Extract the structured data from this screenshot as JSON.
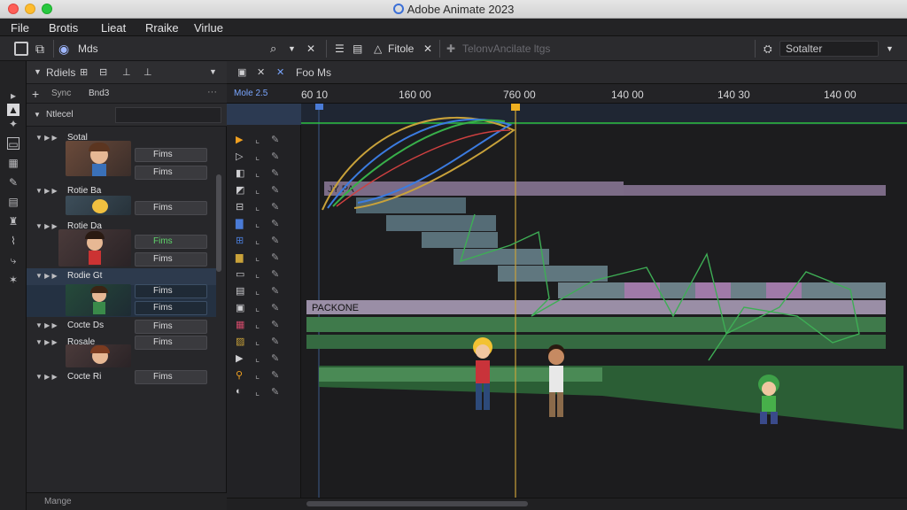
{
  "window": {
    "title": "Adobe Animate 2023"
  },
  "menu": [
    "File",
    "Brotis",
    "Lieat",
    "Rraike",
    "Virlue"
  ],
  "toolbar": {
    "scene_label": "Mds",
    "frame_label": "Fitole",
    "center_placeholder": "TelonvAncilate ltgs",
    "workspace_value": "Sotalter"
  },
  "layers_panel": {
    "header_label": "Rdiels",
    "add_label": "Bnd3",
    "group_label": "Ntlecel",
    "footer_label": "Mange",
    "rows": [
      {
        "name": "Sotal",
        "frame": "Fims",
        "frame2": "Fims"
      },
      {
        "name": "Rotie Ba",
        "frame": "Fims",
        "frame2": "Fims"
      },
      {
        "name": "Rotie Da",
        "frame": "Fims",
        "frame2": "Fims"
      },
      {
        "name": "Rodie Gt",
        "frame": "Fims",
        "frame2": "Fims"
      },
      {
        "name": "Cocte Ds",
        "frame": "Fims"
      },
      {
        "name": "Rosale",
        "frame": "Fims"
      },
      {
        "name": "Cocte Ri",
        "frame": "Fims"
      }
    ]
  },
  "timeline": {
    "scene_tab": "Mole 2.5",
    "head_label": "Foo Ms",
    "ruler_labels": [
      "60 10",
      "160 00",
      "760 00",
      "140 00",
      "140 30",
      "140 00"
    ],
    "track_label_1": "JY PA",
    "track_label_2": "PACKONE"
  }
}
